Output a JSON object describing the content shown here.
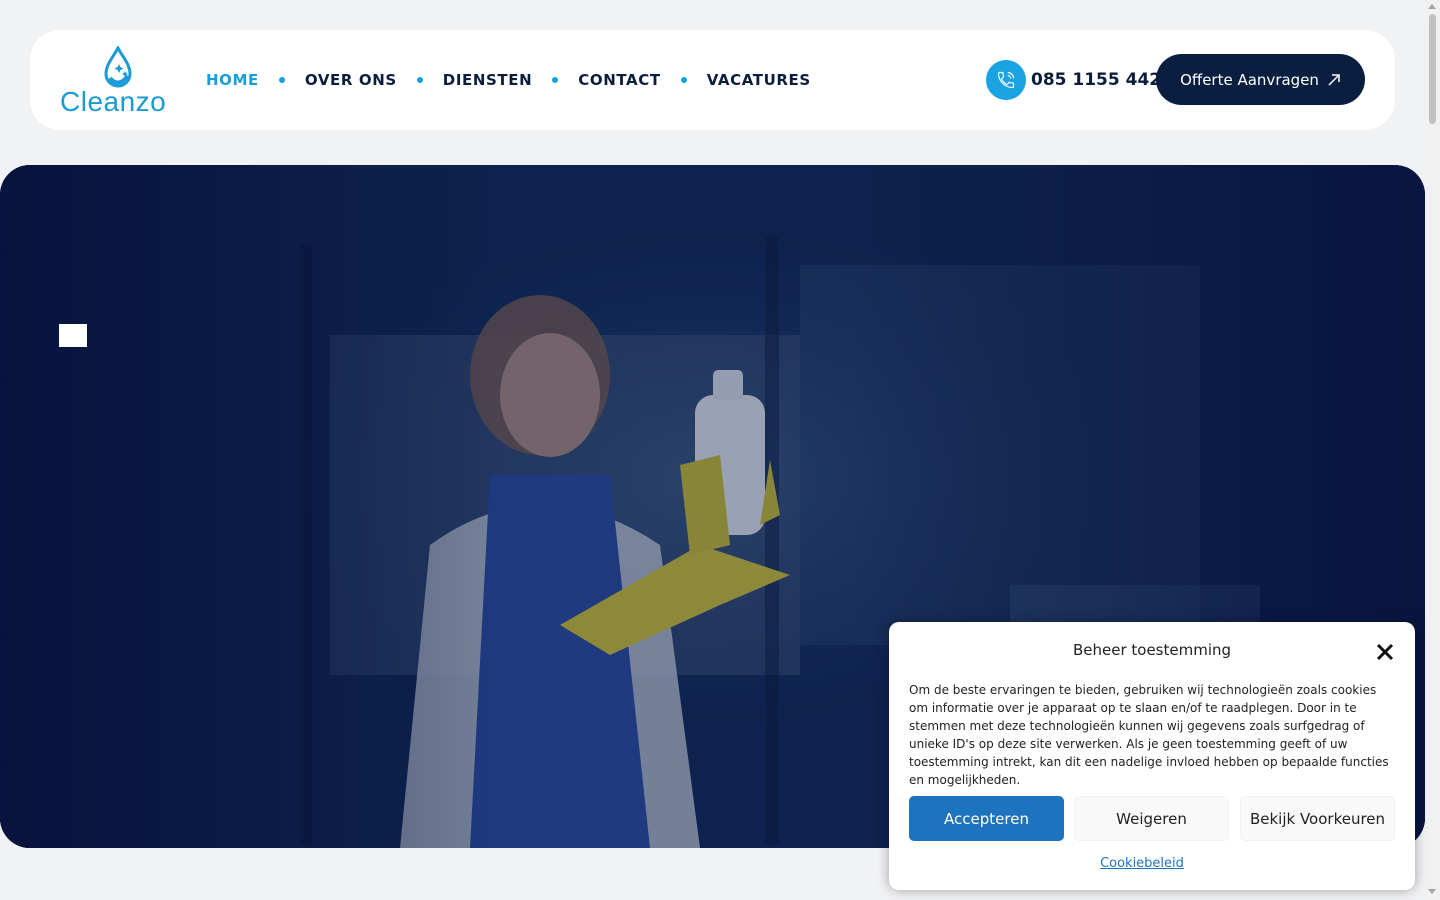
{
  "brand": {
    "name": "Cleanzo",
    "accent": "#13a0dc",
    "navy": "#0a1e40"
  },
  "nav": {
    "items": [
      {
        "label": "HOME",
        "active": true
      },
      {
        "label": "OVER ONS",
        "active": false
      },
      {
        "label": "DIENSTEN",
        "active": false
      },
      {
        "label": "CONTACT",
        "active": false
      },
      {
        "label": "VACATURES",
        "active": false
      }
    ]
  },
  "header": {
    "phone": "085 1155 442",
    "phone_icon": "phone-icon",
    "quote_button": "Offerte Aanvragen",
    "quote_icon": "arrow-up-right-icon"
  },
  "cookie": {
    "title": "Beheer toestemming",
    "text": "Om de beste ervaringen te bieden, gebruiken wij technologieën zoals cookies om informatie over je apparaat op te slaan en/of te raadplegen. Door in te stemmen met deze technologieën kunnen wij gegevens zoals surfgedrag of unieke ID's op deze site verwerken. Als je geen toestemming geeft of uw toestemming intrekt, kan dit een nadelige invloed hebben op bepaalde functies en mogelijkheden.",
    "accept": "Accepteren",
    "deny": "Weigeren",
    "preferences": "Bekijk Voorkeuren",
    "policy_link": "Cookiebeleid",
    "accept_color": "#1e73be"
  }
}
